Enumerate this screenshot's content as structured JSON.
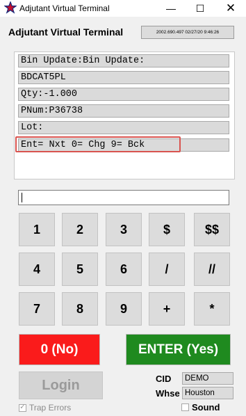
{
  "window": {
    "title": "Adjutant Virtual Terminal",
    "icon": "red-blue-star-icon",
    "minimize": "—",
    "maximize": "☐",
    "close": "✕"
  },
  "header": {
    "title": "Adjutant Virtual Terminal",
    "info": "2002.690.497 02/27/20  9:46:26"
  },
  "screen": {
    "lines": [
      "Bin Update:Bin Update:",
      "BDCAT5PL",
      "Qty:-1.000",
      "PNum:P36738",
      "Lot:",
      "Ent= Nxt 0= Chg 9= Bck"
    ],
    "input_value": ""
  },
  "keypad": {
    "rows": [
      [
        "1",
        "2",
        "3",
        "$",
        "$$"
      ],
      [
        "4",
        "5",
        "6",
        "/",
        "//"
      ],
      [
        "7",
        "8",
        "9",
        "+",
        "*"
      ]
    ]
  },
  "buttons": {
    "no": "0 (No)",
    "enter": "ENTER (Yes)",
    "login": "Login"
  },
  "fields": {
    "cid_label": "CID",
    "cid_value": "DEMO",
    "whse_label": "Whse",
    "whse_value": "Houston"
  },
  "checkboxes": {
    "trap_errors": "Trap Errors",
    "trap_errors_checked": true,
    "sound": "Sound",
    "sound_checked": false
  },
  "colors": {
    "no_button": "#fa1b1b",
    "enter_button": "#1f8a1f",
    "highlight_border": "#d9534f"
  }
}
